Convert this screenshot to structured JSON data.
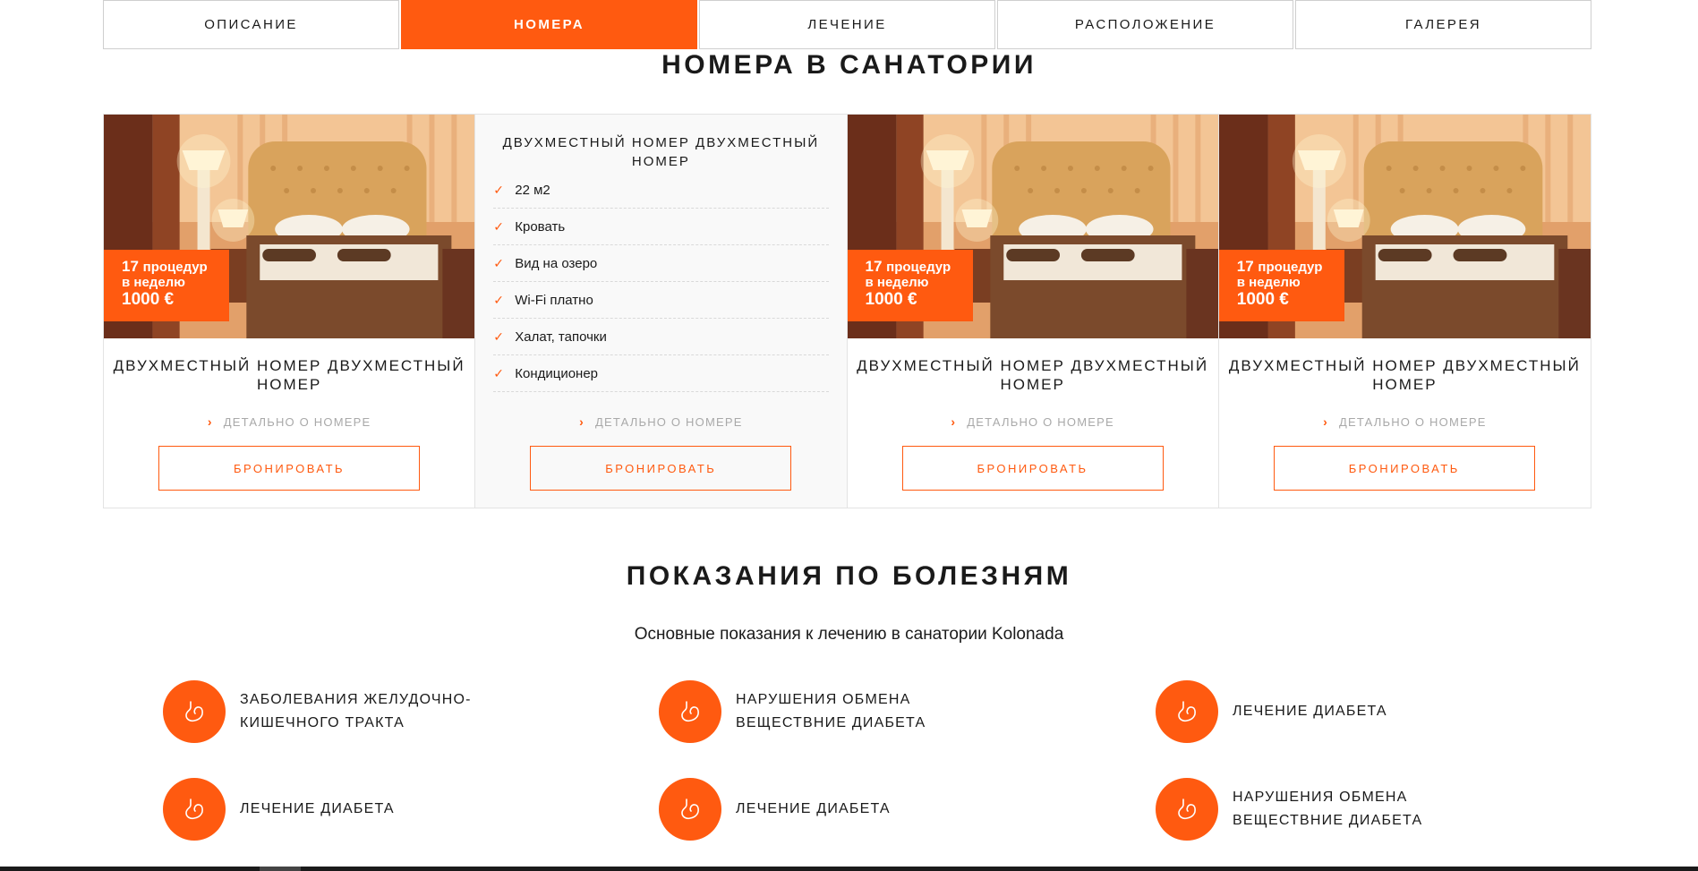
{
  "tabs": [
    {
      "label": "Описание",
      "active": false
    },
    {
      "label": "Номера",
      "active": true
    },
    {
      "label": "Лечение",
      "active": false
    },
    {
      "label": "Расположение",
      "active": false
    },
    {
      "label": "Галерея",
      "active": false
    }
  ],
  "rooms_section": {
    "title": "Номера в санатории",
    "rooms": [
      {
        "procedures_count": "17",
        "procedures_unit": "процедур",
        "procedures_period": "в неделю",
        "price": "1000 €",
        "title": "Двухместный номер двухместный номер",
        "detail_link": "Детально о номере",
        "book_label": "Бронировать"
      },
      {
        "expanded": true,
        "title": "Двухместный номер двухместный номер",
        "amenities": [
          "22 м2",
          "Кровать",
          "Вид на озеро",
          "Wi-Fi платно",
          "Халат, тапочки",
          "Кондиционер"
        ],
        "detail_link": "Детально о номере",
        "book_label": "Бронировать"
      },
      {
        "procedures_count": "17",
        "procedures_unit": "процедур",
        "procedures_period": "в неделю",
        "price": "1000 €",
        "title": "Двухместный номер двухместный номер",
        "detail_link": "Детально о номере",
        "book_label": "Бронировать"
      },
      {
        "procedures_count": "17",
        "procedures_unit": "процедур",
        "procedures_period": "в неделю",
        "price": "1000 €",
        "title": "Двухместный номер двухместный номер",
        "detail_link": "Детально о номере",
        "book_label": "Бронировать"
      }
    ]
  },
  "diseases_section": {
    "title": "Показания по болезням",
    "subtitle": "Основные показания к лечению в санатории Kolonada",
    "items": [
      {
        "label": "Заболевания желудочно-кишечного тракта",
        "icon": "stomach-icon"
      },
      {
        "label": "Нарушения обмена веществние диабета",
        "icon": "stomach-icon"
      },
      {
        "label": "Лечение диабета",
        "icon": "stomach-icon"
      },
      {
        "label": "Лечение диабета",
        "icon": "stomach-icon"
      },
      {
        "label": "Лечение диабета",
        "icon": "stomach-icon"
      },
      {
        "label": "Нарушения обмена веществние диабета",
        "icon": "stomach-icon"
      }
    ]
  },
  "colors": {
    "accent": "#ff5a10",
    "text": "#1a1a1a",
    "muted": "#a9a9a9",
    "border": "#e3e3e3"
  }
}
